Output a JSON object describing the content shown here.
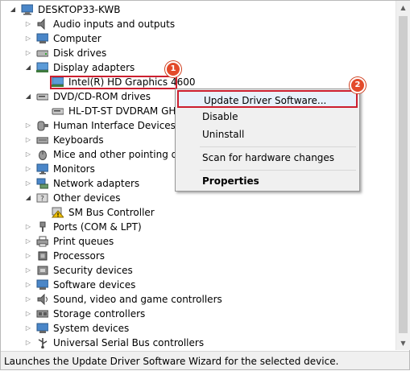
{
  "tree": {
    "root": "DESKTOP33-KWB",
    "items": [
      {
        "label": "Audio inputs and outputs",
        "icon": "speaker-icon"
      },
      {
        "label": "Computer",
        "icon": "computer-icon"
      },
      {
        "label": "Disk drives",
        "icon": "disk-drive-icon"
      },
      {
        "label": "Display adapters",
        "icon": "display-adapter-icon",
        "expanded": true
      },
      {
        "label": "Intel(R) HD Graphics 4600",
        "icon": "display-adapter-icon",
        "child": true,
        "selected": true
      },
      {
        "label": "DVD/CD-ROM drives",
        "icon": "dvd-drive-icon",
        "expanded": true
      },
      {
        "label": "HL-DT-ST DVDRAM GH24NSD1",
        "icon": "dvd-drive-icon",
        "child": true
      },
      {
        "label": "Human Interface Devices",
        "icon": "hid-icon"
      },
      {
        "label": "Keyboards",
        "icon": "keyboard-icon"
      },
      {
        "label": "Mice and other pointing devices",
        "icon": "mouse-icon"
      },
      {
        "label": "Monitors",
        "icon": "monitor-icon"
      },
      {
        "label": "Network adapters",
        "icon": "network-adapter-icon"
      },
      {
        "label": "Other devices",
        "icon": "other-devices-icon",
        "expanded": true
      },
      {
        "label": "SM Bus Controller",
        "icon": "warning-device-icon",
        "child": true
      },
      {
        "label": "Ports (COM & LPT)",
        "icon": "port-icon"
      },
      {
        "label": "Print queues",
        "icon": "printer-icon"
      },
      {
        "label": "Processors",
        "icon": "processor-icon"
      },
      {
        "label": "Security devices",
        "icon": "security-device-icon"
      },
      {
        "label": "Software devices",
        "icon": "software-device-icon"
      },
      {
        "label": "Sound, video and game controllers",
        "icon": "sound-controller-icon"
      },
      {
        "label": "Storage controllers",
        "icon": "storage-controller-icon"
      },
      {
        "label": "System devices",
        "icon": "system-devices-icon"
      },
      {
        "label": "Universal Serial Bus controllers",
        "icon": "usb-icon"
      }
    ]
  },
  "context_menu": {
    "update_driver": "Update Driver Software...",
    "disable": "Disable",
    "uninstall": "Uninstall",
    "scan": "Scan for hardware changes",
    "properties": "Properties"
  },
  "badges": {
    "step1": "1",
    "step2": "2"
  },
  "status_bar": "Launches the Update Driver Software Wizard for the selected device.",
  "colors": {
    "highlight_border": "#cc1f2f",
    "badge": "#e34a2a",
    "menu_bg": "#f0f0f0"
  }
}
